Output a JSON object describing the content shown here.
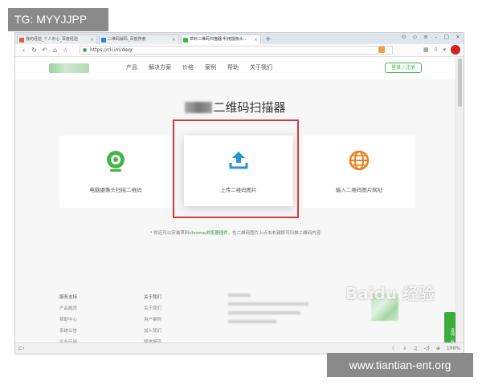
{
  "overlay": {
    "top_tag": "TG: MYYJJPP",
    "bottom_tag": "www.tiantian-ent.org",
    "watermark": "Baidu 经验"
  },
  "browser": {
    "tabs": [
      {
        "label": "我的经验_个人中心_百度经验",
        "active": false,
        "favicon_color": "#e25b3a"
      },
      {
        "label": "二维码解码_百度搜索",
        "active": false,
        "favicon_color": "#3b7be0"
      },
      {
        "label": "草料二维码扫描器-利用摄像头…",
        "active": true,
        "favicon_color": "#42b548"
      }
    ],
    "new_tab": "+",
    "url": "https://cli.im/deqr",
    "lock_icon": "lock-icon"
  },
  "site": {
    "menu": [
      "产品",
      "解决方案",
      "价格",
      "案例",
      "帮助",
      "关于我们"
    ],
    "login_label": "登录 / 注册",
    "title_suffix": "二维码扫描器",
    "cards": {
      "left_label": "电脑摄像头扫描二维码",
      "center_label": "上传二维码图片",
      "right_label": "输入二维码图片网址"
    },
    "tip": {
      "prefix": "* 你还可以安装草料",
      "link": "chrome浏览器插件",
      "suffix": "，在二维码图片上点击右键即可扫描二维码内容"
    },
    "footer": {
      "col1_heading": "服务支持",
      "col1_items": [
        "产品概览",
        "帮助中心",
        "系统公告",
        "企业应用"
      ],
      "col2_heading": "关于我们",
      "col2_items": [
        "关于我们",
        "用户案例",
        "加入我们",
        "媒体报道"
      ]
    },
    "float_widget": "咨询 · 反馈"
  },
  "status": {
    "zoom": "100%"
  },
  "colors": {
    "brand_green": "#42b548",
    "highlight_red": "#d53a3a",
    "upload_blue": "#2196d9",
    "globe_orange": "#ee7d1a"
  }
}
